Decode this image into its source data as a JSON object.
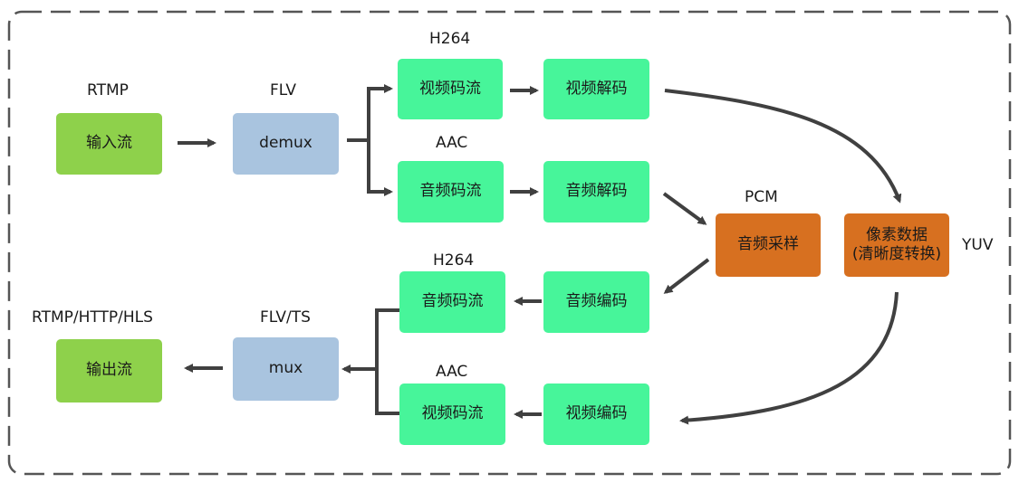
{
  "labels": {
    "rtmp_in": "RTMP",
    "flv_in": "FLV",
    "h264_top": "H264",
    "aac_top": "AAC",
    "pcm": "PCM",
    "yuv": "YUV",
    "h264_bottom": "H264",
    "aac_bottom": "AAC",
    "out_protocols": "RTMP/HTTP/HLS",
    "flv_ts": "FLV/TS"
  },
  "nodes": {
    "input_stream": "输入流",
    "demux": "demux",
    "video_stream_in": "视频码流",
    "video_decode": "视频解码",
    "audio_stream_in": "音频码流",
    "audio_decode": "音频解码",
    "audio_resample": "音频采样",
    "pixel_data_line1": "像素数据",
    "pixel_data_line2": "(清晰度转换)",
    "audio_stream_out": "音频码流",
    "audio_encode": "音频编码",
    "mux": "mux",
    "output_stream": "输出流",
    "video_stream_out": "视频码流",
    "video_encode": "视频编码"
  },
  "colors": {
    "io_node": "#8ed14b",
    "mux_node": "#a9c4df",
    "codec_node": "#47f59a",
    "process_node": "#d77020",
    "arrow": "#404040",
    "frame": "#555555"
  }
}
